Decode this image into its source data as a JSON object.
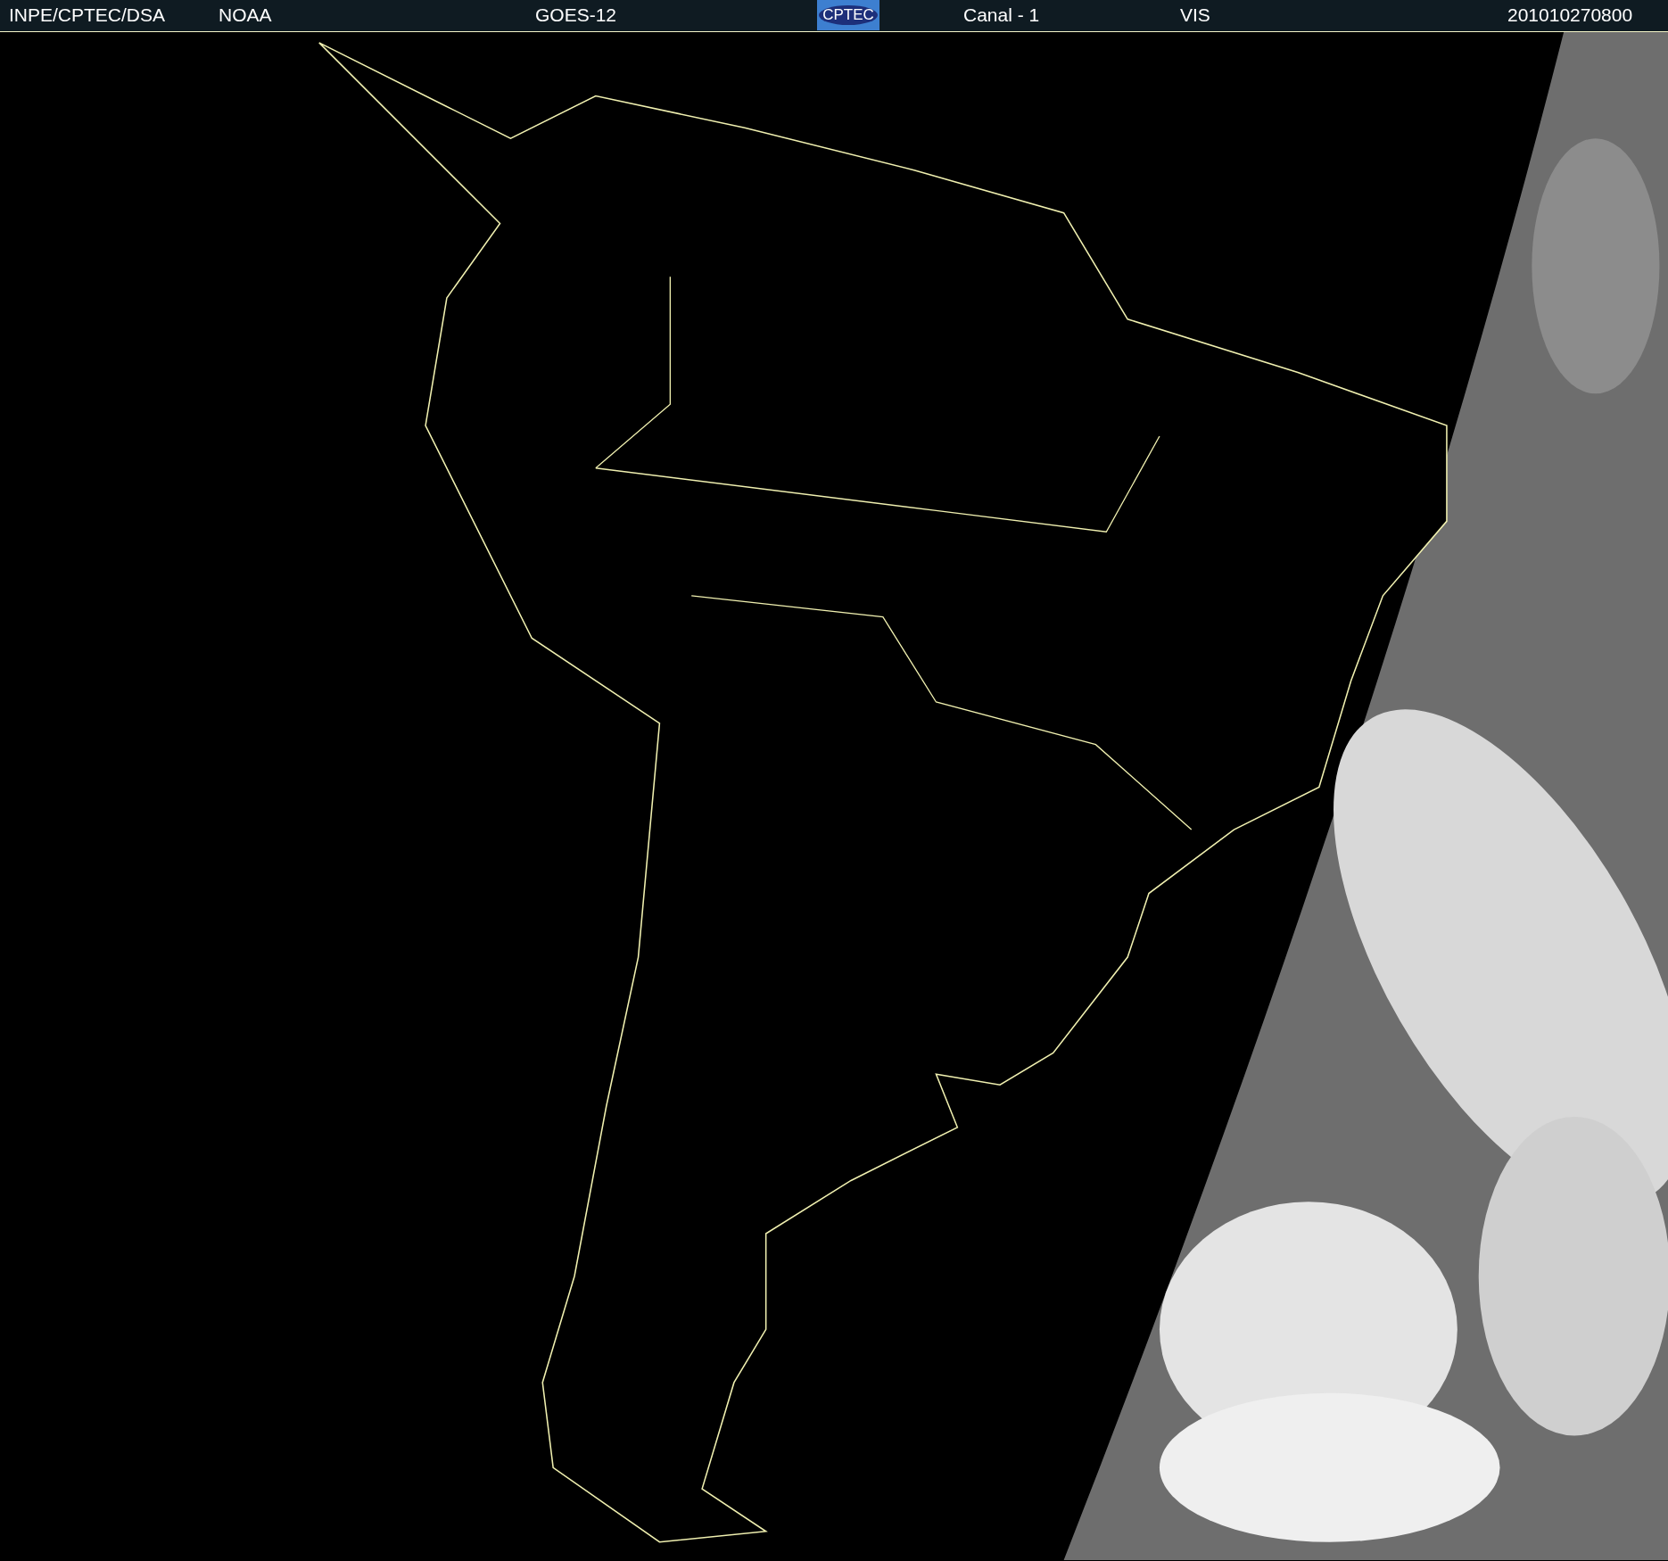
{
  "header": {
    "items": [
      {
        "kind": "text",
        "text": "INPE/CPTEC/DSA"
      },
      {
        "kind": "text",
        "text": "NOAA"
      },
      {
        "kind": "text",
        "text": "GOES-12"
      },
      {
        "kind": "logo",
        "text": "CPTEC"
      },
      {
        "kind": "text",
        "text": "Canal - 1"
      },
      {
        "kind": "text",
        "text": "VIS"
      },
      {
        "kind": "text",
        "text": "201010270800"
      }
    ]
  }
}
